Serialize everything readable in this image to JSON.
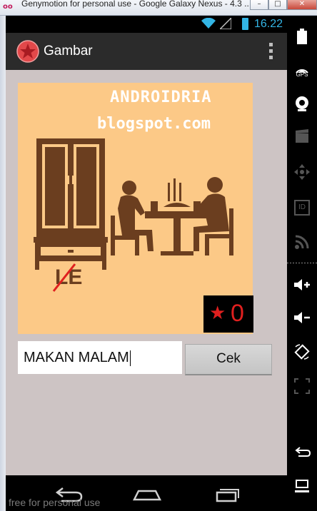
{
  "window": {
    "title": "Genymotion for personal use - Google Galaxy Nexus - 4.3 ...",
    "title_short": "Genymotion for personal use - Google Galaxy Nexus - 4.3 ...",
    "logo_icon": "genymotion-logo-icon",
    "buttons": [
      "minimize",
      "maximize",
      "close"
    ]
  },
  "status_bar": {
    "time": "16.22",
    "icons": [
      "wifi-icon",
      "signal-icon",
      "battery-icon"
    ],
    "accent_color": "#33b5e5"
  },
  "action_bar": {
    "title": "Gambar",
    "app_icon": "red-star-icon",
    "menu_icon": "overflow-menu-icon"
  },
  "puzzle": {
    "watermark_line1": "ANDROIDRIA",
    "watermark_line2": "blogspot.com",
    "clue_text": "LE",
    "background_color": "#fcc987",
    "illustration_color": "#6b3e1f"
  },
  "score": {
    "stars": "0",
    "star_icon": "star-icon",
    "color": "#e0201f"
  },
  "answer": {
    "value": "MAKAN MALAM",
    "check_button": "Cek"
  },
  "nav_bar": {
    "buttons": [
      "back-icon",
      "home-icon",
      "recent-apps-icon"
    ],
    "watermark": "free for personal use"
  },
  "side_panel": {
    "tools": [
      "battery-icon",
      "gps-icon",
      "camera-icon",
      "video-icon",
      "dpad-icon",
      "id-icon",
      "rss-icon",
      "volume-up-icon",
      "volume-down-icon",
      "rotate-icon",
      "fullscreen-icon",
      "back-icon",
      "menu-icon"
    ],
    "gps_label": "GPS",
    "id_label": "ID"
  }
}
